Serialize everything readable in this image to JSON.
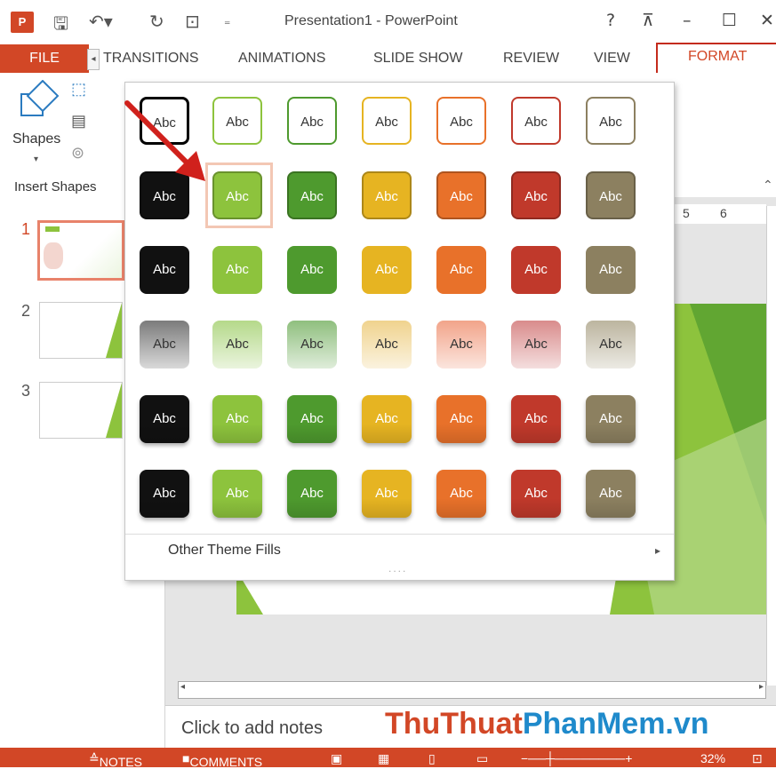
{
  "window": {
    "title": "Presentation1 - PowerPoint",
    "help": "?",
    "app_logo": "P"
  },
  "tabs": {
    "file": "FILE",
    "transitions": "TRANSITIONS",
    "animations": "ANIMATIONS",
    "slide_show": "SLIDE SHOW",
    "review": "REVIEW",
    "view": "VIEW",
    "format": "FORMAT"
  },
  "ribbon": {
    "shapes_label": "Shapes",
    "group_label": "Insert Shapes"
  },
  "thumbnails": {
    "numbers": [
      "1",
      "2",
      "3"
    ]
  },
  "ruler": {
    "marks": [
      "5",
      "6"
    ]
  },
  "gallery": {
    "swatch_label": "Abc",
    "other_theme_fills": "Other Theme Fills",
    "rows": [
      [
        "#000000",
        "#8dc33d",
        "#4e9a2e",
        "#e6b422",
        "#e8712a",
        "#c0392b",
        "#8c8060"
      ],
      [
        "#111111",
        "#8dc33d",
        "#4e9a2e",
        "#e6b422",
        "#e8712a",
        "#c0392b",
        "#8c8060"
      ],
      [
        "#111111",
        "#8dc33d",
        "#4e9a2e",
        "#e6b422",
        "#e8712a",
        "#c0392b",
        "#8c8060"
      ],
      [
        "#7b7b7b",
        "#b5d98a",
        "#8fbf7e",
        "#f0d38e",
        "#f2a48a",
        "#d98c8c",
        "#bcb59f"
      ],
      [
        "#111111",
        "#8dc33d",
        "#4e9a2e",
        "#e6b422",
        "#e8712a",
        "#c0392b",
        "#8c8060"
      ],
      [
        "#111111",
        "#8dc33d",
        "#4e9a2e",
        "#e6b422",
        "#e8712a",
        "#c0392b",
        "#8c8060"
      ]
    ]
  },
  "notes": {
    "placeholder": "Click to add notes"
  },
  "status": {
    "notes": "NOTES",
    "comments": "COMMENTS",
    "zoom": "32%"
  },
  "watermark": {
    "part1": "ThuThuat",
    "part2": "PhanMem.vn"
  },
  "colors": {
    "accent": "#d24726",
    "highlight_border": "#c42b1c",
    "selection": "#f3c7b4",
    "arrow": "#d0211c"
  }
}
